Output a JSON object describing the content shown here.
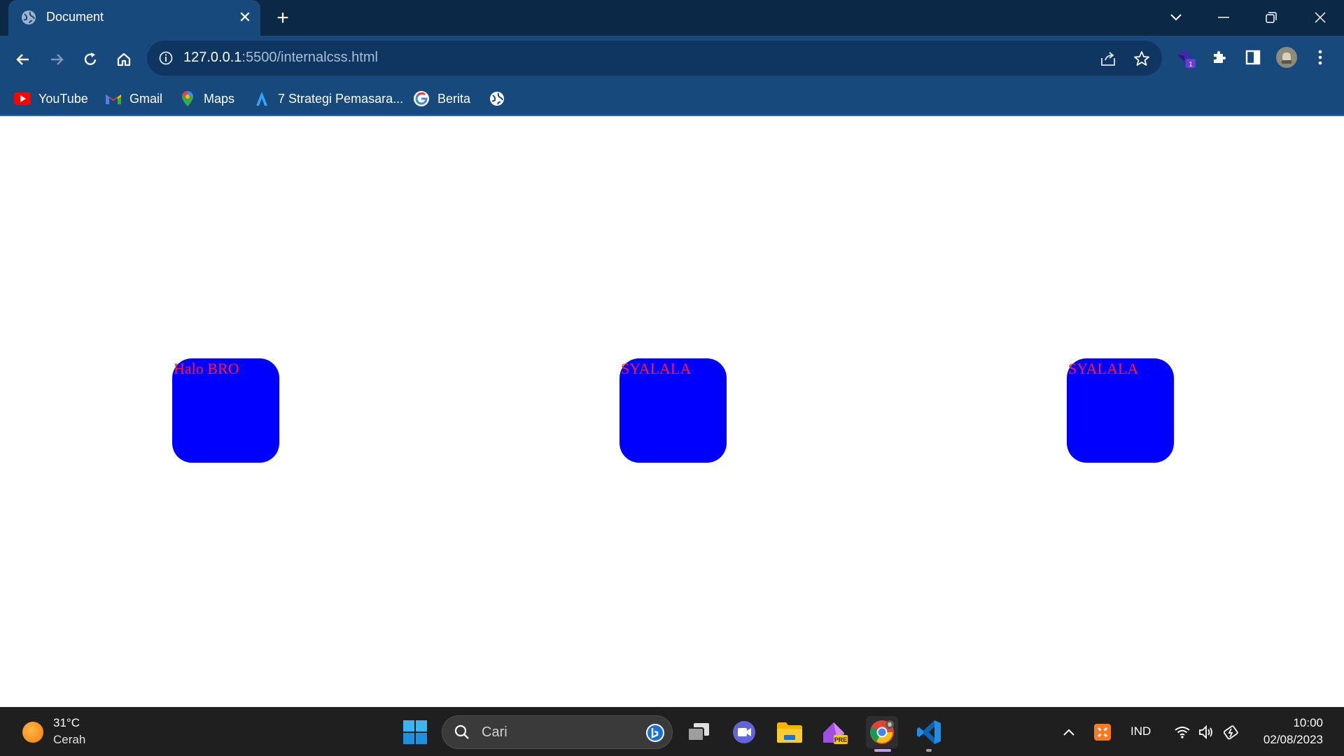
{
  "browser": {
    "tab": {
      "title": "Document",
      "favicon": "globe-icon"
    },
    "address": {
      "host": "127.0.0.1",
      "path": ":5500/internalcss.html"
    },
    "bookmarks": [
      {
        "label": "YouTube",
        "icon": "youtube-icon"
      },
      {
        "label": "Gmail",
        "icon": "gmail-icon"
      },
      {
        "label": "Maps",
        "icon": "maps-icon"
      },
      {
        "label": "7 Strategi Pemasara...",
        "icon": "bookmark-a-icon"
      },
      {
        "label": "Berita",
        "icon": "google-icon"
      },
      {
        "label": "",
        "icon": "globe-icon"
      }
    ],
    "extension_badge": "1"
  },
  "page": {
    "boxes": [
      {
        "text": "Halo BRO"
      },
      {
        "text": "SYALALA"
      },
      {
        "text": "SYALALA"
      }
    ],
    "colors": {
      "box": "#0000ff",
      "text": "#ff1744"
    }
  },
  "taskbar": {
    "weather": {
      "temp": "31°C",
      "desc": "Cerah"
    },
    "search_placeholder": "Cari",
    "language": "IND",
    "time": "10:00",
    "date": "02/08/2023",
    "pre_badge": "PRE"
  }
}
